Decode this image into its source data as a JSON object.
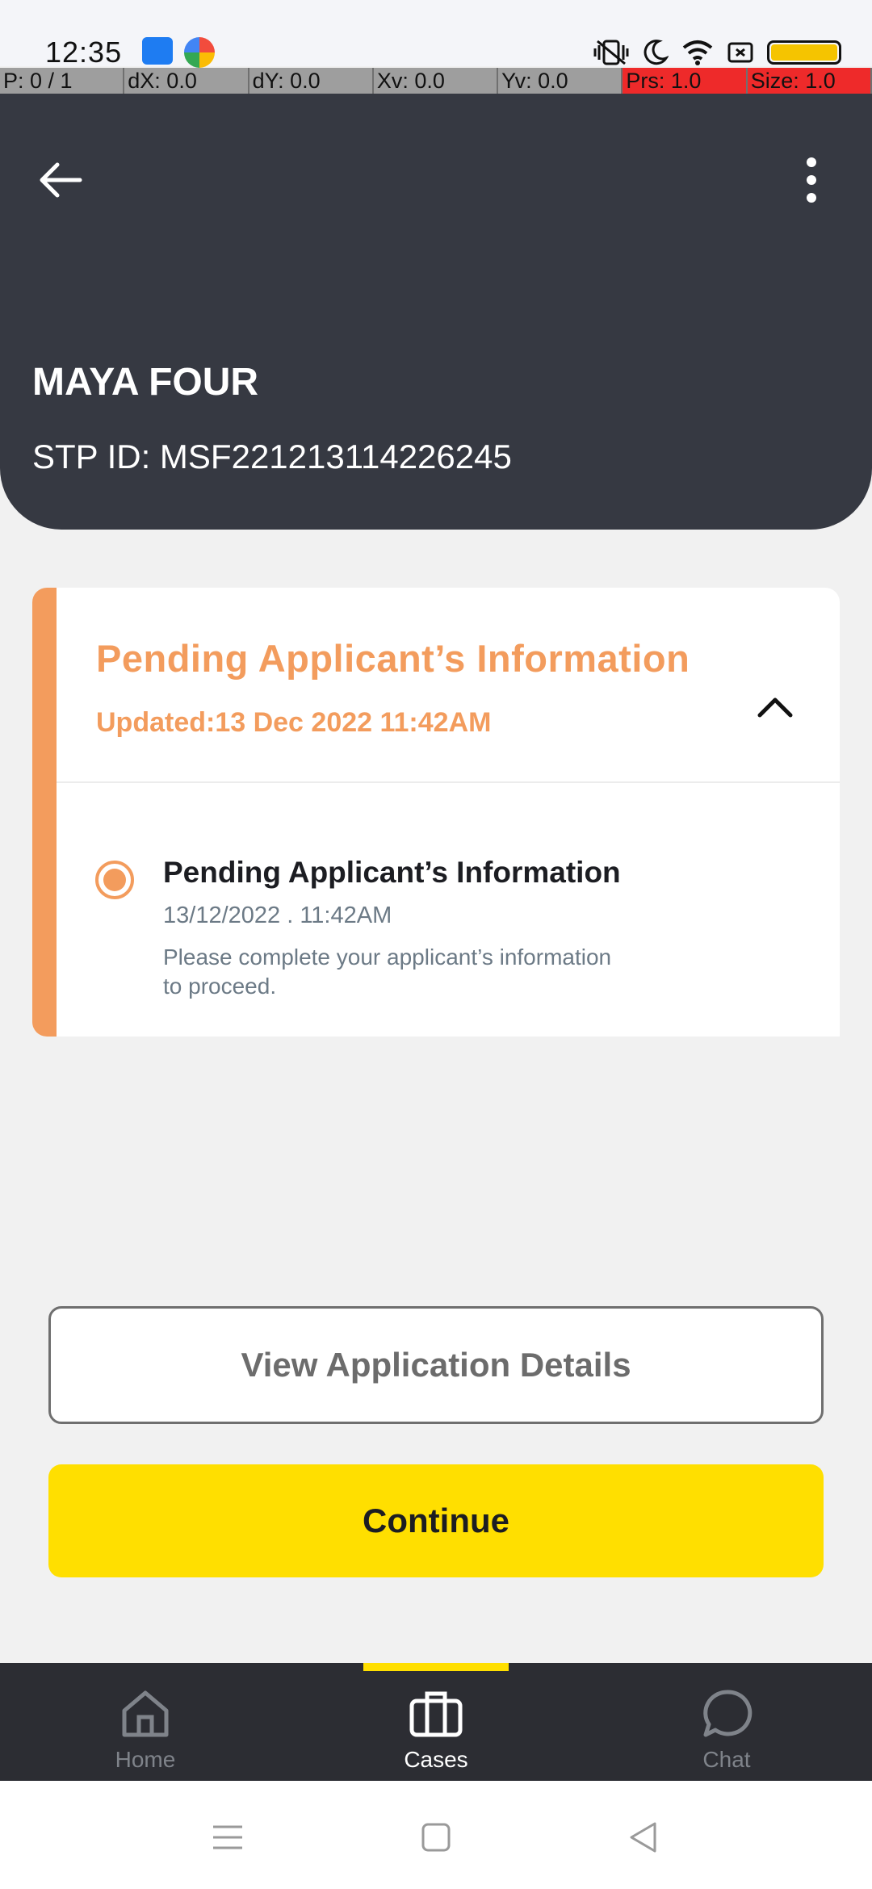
{
  "status_bar": {
    "time": "12:35",
    "icons": [
      "android-debug-icon",
      "browser-icon",
      "vibrate-icon",
      "do-not-disturb-icon",
      "wifi-icon",
      "sim-icon",
      "battery-icon"
    ]
  },
  "debug_overlay": {
    "pointer": "P: 0 / 1",
    "dx": "dX: 0.0",
    "dy": "dY: 0.0",
    "xv": "Xv: 0.0",
    "yv": "Yv: 0.0",
    "prs": "Prs: 1.0",
    "size": "Size: 1.0"
  },
  "header": {
    "name": "MAYA FOUR",
    "stp_id": "STP ID: MSF221213114226245"
  },
  "status_card": {
    "title": "Pending Applicant’s Information",
    "updated": "Updated:13 Dec 2022 11:42AM",
    "step": {
      "title": "Pending Applicant’s Information",
      "date": "13/12/2022 . 11:42AM",
      "description": "Please complete your applicant’s information to proceed."
    }
  },
  "actions": {
    "view_details_label": "View Application Details",
    "continue_label": "Continue"
  },
  "bottom_nav": {
    "items": [
      {
        "label": "Home",
        "icon": "home-icon"
      },
      {
        "label": "Cases",
        "icon": "briefcase-icon"
      },
      {
        "label": "Chat",
        "icon": "chat-icon"
      }
    ],
    "active": "Cases"
  },
  "colors": {
    "header_bg": "#363942",
    "accent_orange": "#f39c5d",
    "primary_yellow": "#ffdf00",
    "nav_bg": "#2c2d33"
  }
}
